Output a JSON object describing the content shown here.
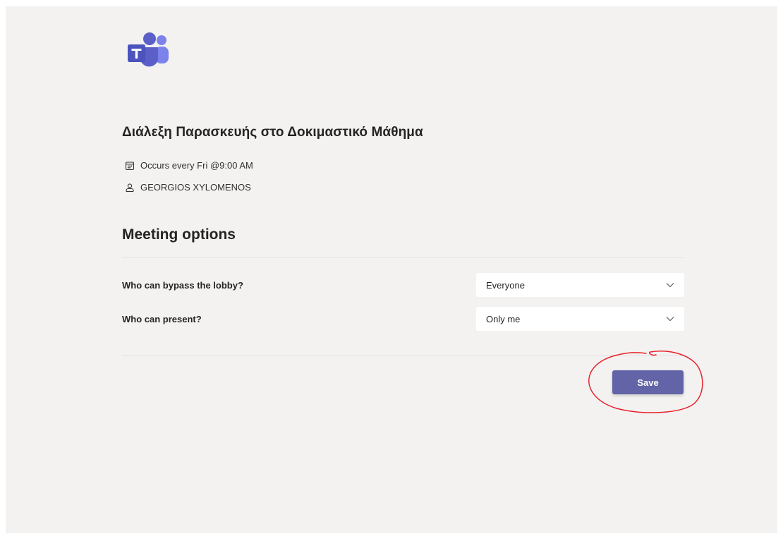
{
  "meeting": {
    "title": "Διάλεξη Παρασκευής στο Δοκιμαστικό Μάθημα",
    "recurrence": "Occurs every Fri @9:00 AM",
    "organizer": "GEORGIOS XYLOMENOS"
  },
  "options": {
    "heading": "Meeting options",
    "items": [
      {
        "label": "Who can bypass the lobby?",
        "value": "Everyone"
      },
      {
        "label": "Who can present?",
        "value": "Only me"
      }
    ]
  },
  "actions": {
    "save_label": "Save"
  },
  "colors": {
    "page_background": "#f3f2f1",
    "brand_purple": "#6264a7",
    "annotation_red": "#e8202a"
  },
  "icons": {
    "logo": "teams-logo-icon",
    "recurrence": "calendar-icon",
    "organizer": "person-icon",
    "dropdown": "chevron-down-icon"
  }
}
